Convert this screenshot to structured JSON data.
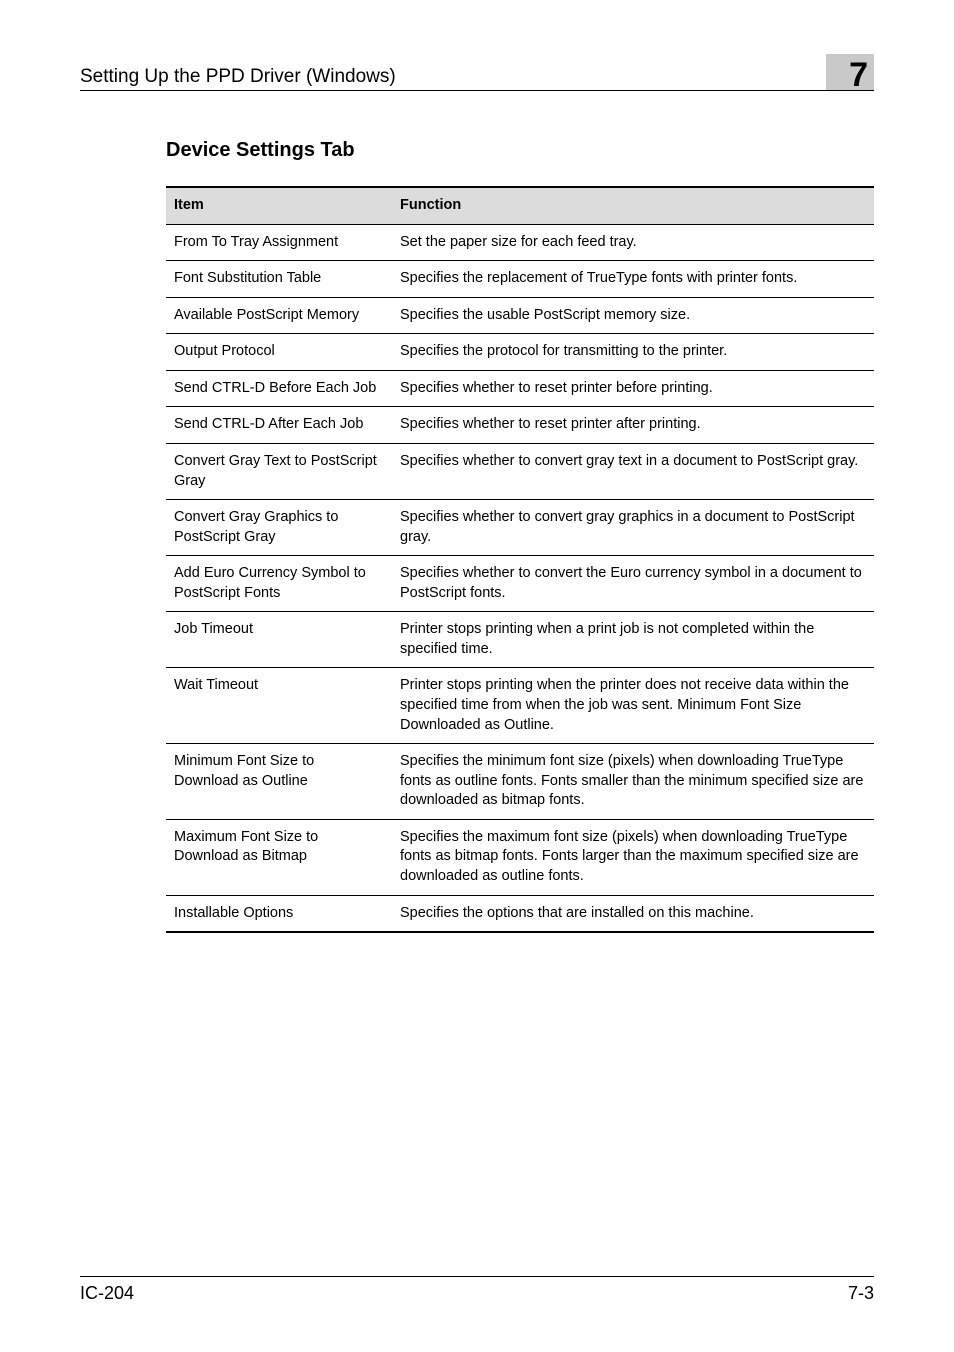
{
  "header": {
    "title": "Setting Up the PPD Driver (Windows)",
    "chapter": "7"
  },
  "section_title": "Device Settings Tab",
  "table": {
    "headers": {
      "item": "Item",
      "function": "Function"
    },
    "rows": [
      {
        "item": "From To Tray Assignment",
        "function": "Set the paper size for each feed tray."
      },
      {
        "item": "Font Substitution Table",
        "function": "Specifies the replacement of TrueType fonts with printer fonts."
      },
      {
        "item": "Available PostScript Memory",
        "function": "Specifies the usable PostScript memory size."
      },
      {
        "item": "Output Protocol",
        "function": "Specifies the protocol for transmitting to the printer."
      },
      {
        "item": "Send CTRL-D Before Each Job",
        "function": "Specifies whether to reset printer before printing."
      },
      {
        "item": "Send CTRL-D After Each Job",
        "function": "Specifies whether to reset printer after printing."
      },
      {
        "item": "Convert Gray Text to PostScript Gray",
        "function": "Specifies whether to convert gray text in a document to PostScript gray."
      },
      {
        "item": "Convert Gray Graphics to PostScript Gray",
        "function": "Specifies whether to convert gray graphics in a document to PostScript gray."
      },
      {
        "item": "Add Euro Currency Symbol to PostScript Fonts",
        "function": "Specifies whether to convert the Euro currency symbol in a document to PostScript fonts."
      },
      {
        "item": "Job Timeout",
        "function": "Printer stops printing when a print job is not completed within the specified time."
      },
      {
        "item": "Wait Timeout",
        "function": "Printer stops printing when the printer does not receive data within the specified time from when the job was sent. Minimum Font Size Downloaded as Outline."
      },
      {
        "item": "Minimum Font Size to Download as Outline",
        "function": "Specifies the minimum font size (pixels) when downloading TrueType fonts as outline fonts. Fonts smaller than the minimum specified size are downloaded as bitmap fonts."
      },
      {
        "item": "Maximum Font Size to Download as Bitmap",
        "function": "Specifies the maximum font size (pixels) when downloading TrueType fonts as bitmap fonts. Fonts larger than the maximum specified size are downloaded as outline fonts."
      },
      {
        "item": "Installable Options",
        "function": "Specifies the options that are installed on this machine."
      }
    ]
  },
  "footer": {
    "left": "IC-204",
    "right": "7-3"
  }
}
